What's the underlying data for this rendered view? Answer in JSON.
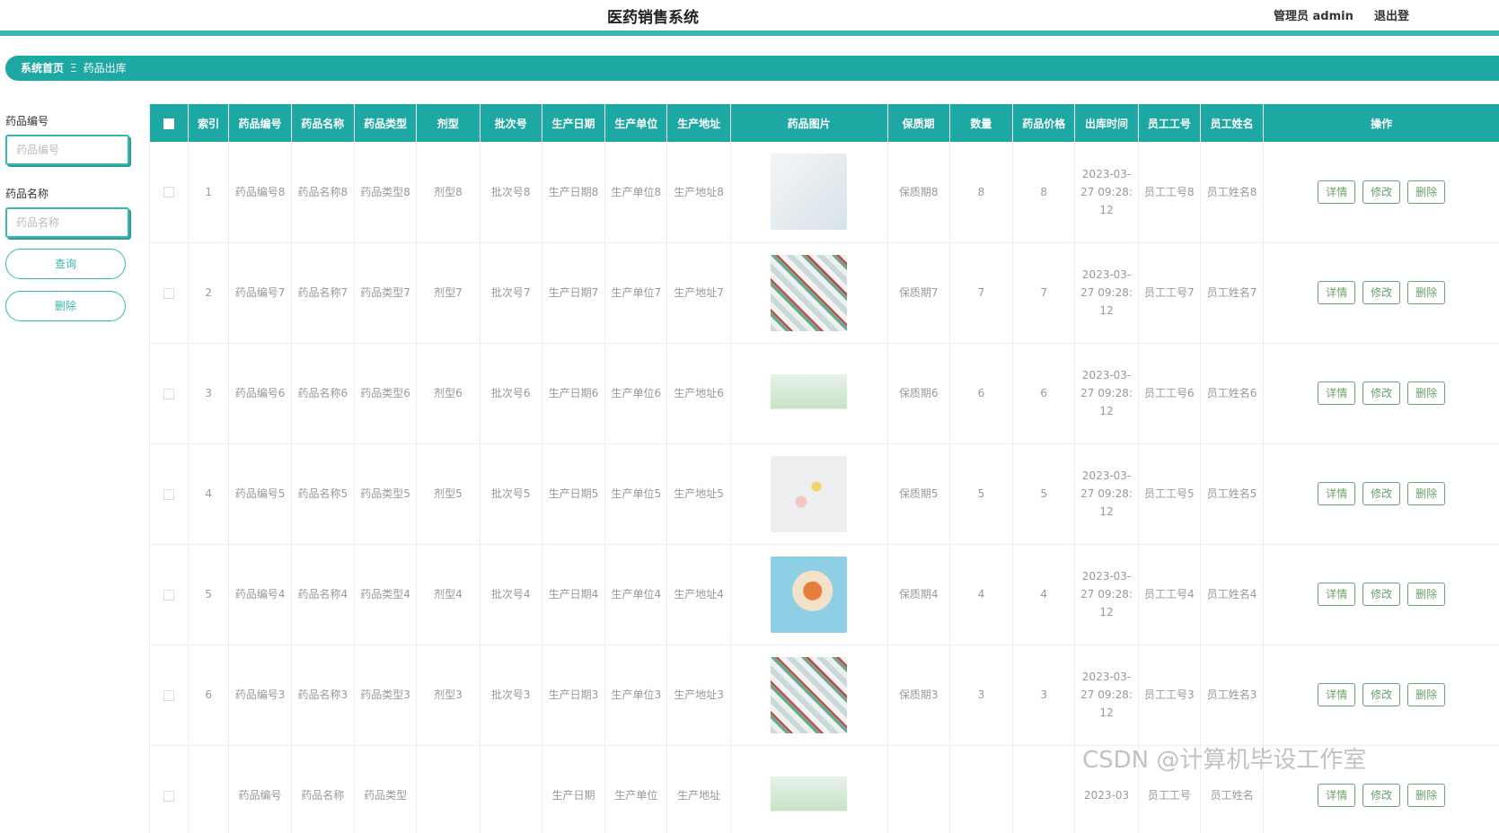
{
  "header": {
    "title": "医药销售系统",
    "user": "管理员 admin",
    "logout": "退出登"
  },
  "breadcrumb": {
    "home": "系统首页",
    "separator": "Ξ",
    "current": "药品出库"
  },
  "search": {
    "code_label": "药品编号",
    "code_placeholder": "药品编号",
    "name_label": "药品名称",
    "name_placeholder": "药品名称",
    "query_button": "查询",
    "delete_button": "删除"
  },
  "table": {
    "columns": [
      "索引",
      "药品编号",
      "药品名称",
      "药品类型",
      "剂型",
      "批次号",
      "生产日期",
      "生产单位",
      "生产地址",
      "药品图片",
      "保质期",
      "数量",
      "药品价格",
      "出库时间",
      "员工工号",
      "员工姓名",
      "操作"
    ],
    "actions": [
      "详情",
      "修改",
      "删除"
    ],
    "rows": [
      {
        "idx": "1",
        "code": "药品编号8",
        "name": "药品名称8",
        "type": "药品类型8",
        "form": "剂型8",
        "batch": "批次号8",
        "date": "生产日期8",
        "unit": "生产单位8",
        "addr": "生产地址8",
        "img": "pill-bottle-image",
        "shelf": "保质期8",
        "qty": "8",
        "price": "8",
        "time": "2023-03-27 09:28:12",
        "eid": "员工工号8",
        "ename": "员工姓名8"
      },
      {
        "idx": "2",
        "code": "药品编号7",
        "name": "药品名称7",
        "type": "药品类型7",
        "form": "剂型7",
        "batch": "批次号7",
        "date": "生产日期7",
        "unit": "生产单位7",
        "addr": "生产地址7",
        "img": "capsules-image",
        "shelf": "保质期7",
        "qty": "7",
        "price": "7",
        "time": "2023-03-27 09:28:12",
        "eid": "员工工号7",
        "ename": "员工姓名7"
      },
      {
        "idx": "3",
        "code": "药品编号6",
        "name": "药品名称6",
        "type": "药品类型6",
        "form": "剂型6",
        "batch": "批次号6",
        "date": "生产日期6",
        "unit": "生产单位6",
        "addr": "生产地址6",
        "img": "medicine-box-image",
        "shelf": "保质期6",
        "qty": "6",
        "price": "6",
        "time": "2023-03-27 09:28:12",
        "eid": "员工工号6",
        "ename": "员工姓名6"
      },
      {
        "idx": "4",
        "code": "药品编号5",
        "name": "药品名称5",
        "type": "药品类型5",
        "form": "剂型5",
        "batch": "批次号5",
        "date": "生产日期5",
        "unit": "生产单位5",
        "addr": "生产地址5",
        "img": "spilled-pills-image",
        "shelf": "保质期5",
        "qty": "5",
        "price": "5",
        "time": "2023-03-27 09:28:12",
        "eid": "员工工号5",
        "ename": "员工姓名5"
      },
      {
        "idx": "5",
        "code": "药品编号4",
        "name": "药品名称4",
        "type": "药品类型4",
        "form": "剂型4",
        "batch": "批次号4",
        "date": "生产日期4",
        "unit": "生产单位4",
        "addr": "生产地址4",
        "img": "pill-spoon-image",
        "shelf": "保质期4",
        "qty": "4",
        "price": "4",
        "time": "2023-03-27 09:28:12",
        "eid": "员工工号4",
        "ename": "员工姓名4"
      },
      {
        "idx": "6",
        "code": "药品编号3",
        "name": "药品名称3",
        "type": "药品类型3",
        "form": "剂型3",
        "batch": "批次号3",
        "date": "生产日期3",
        "unit": "生产单位3",
        "addr": "生产地址3",
        "img": "capsules-image",
        "shelf": "保质期3",
        "qty": "3",
        "price": "3",
        "time": "2023-03-27 09:28:12",
        "eid": "员工工号3",
        "ename": "员工姓名3"
      },
      {
        "idx": "",
        "code": "药品编号",
        "name": "药品名称",
        "type": "药品类型",
        "form": "",
        "batch": "",
        "date": "生产日期",
        "unit": "生产单位",
        "addr": "生产地址",
        "img": "medicine-box-image",
        "shelf": "",
        "qty": "",
        "price": "",
        "time": "2023-03",
        "eid": "员工工号",
        "ename": "员工姓名"
      }
    ]
  },
  "watermark": "CSDN @计算机毕设工作室"
}
